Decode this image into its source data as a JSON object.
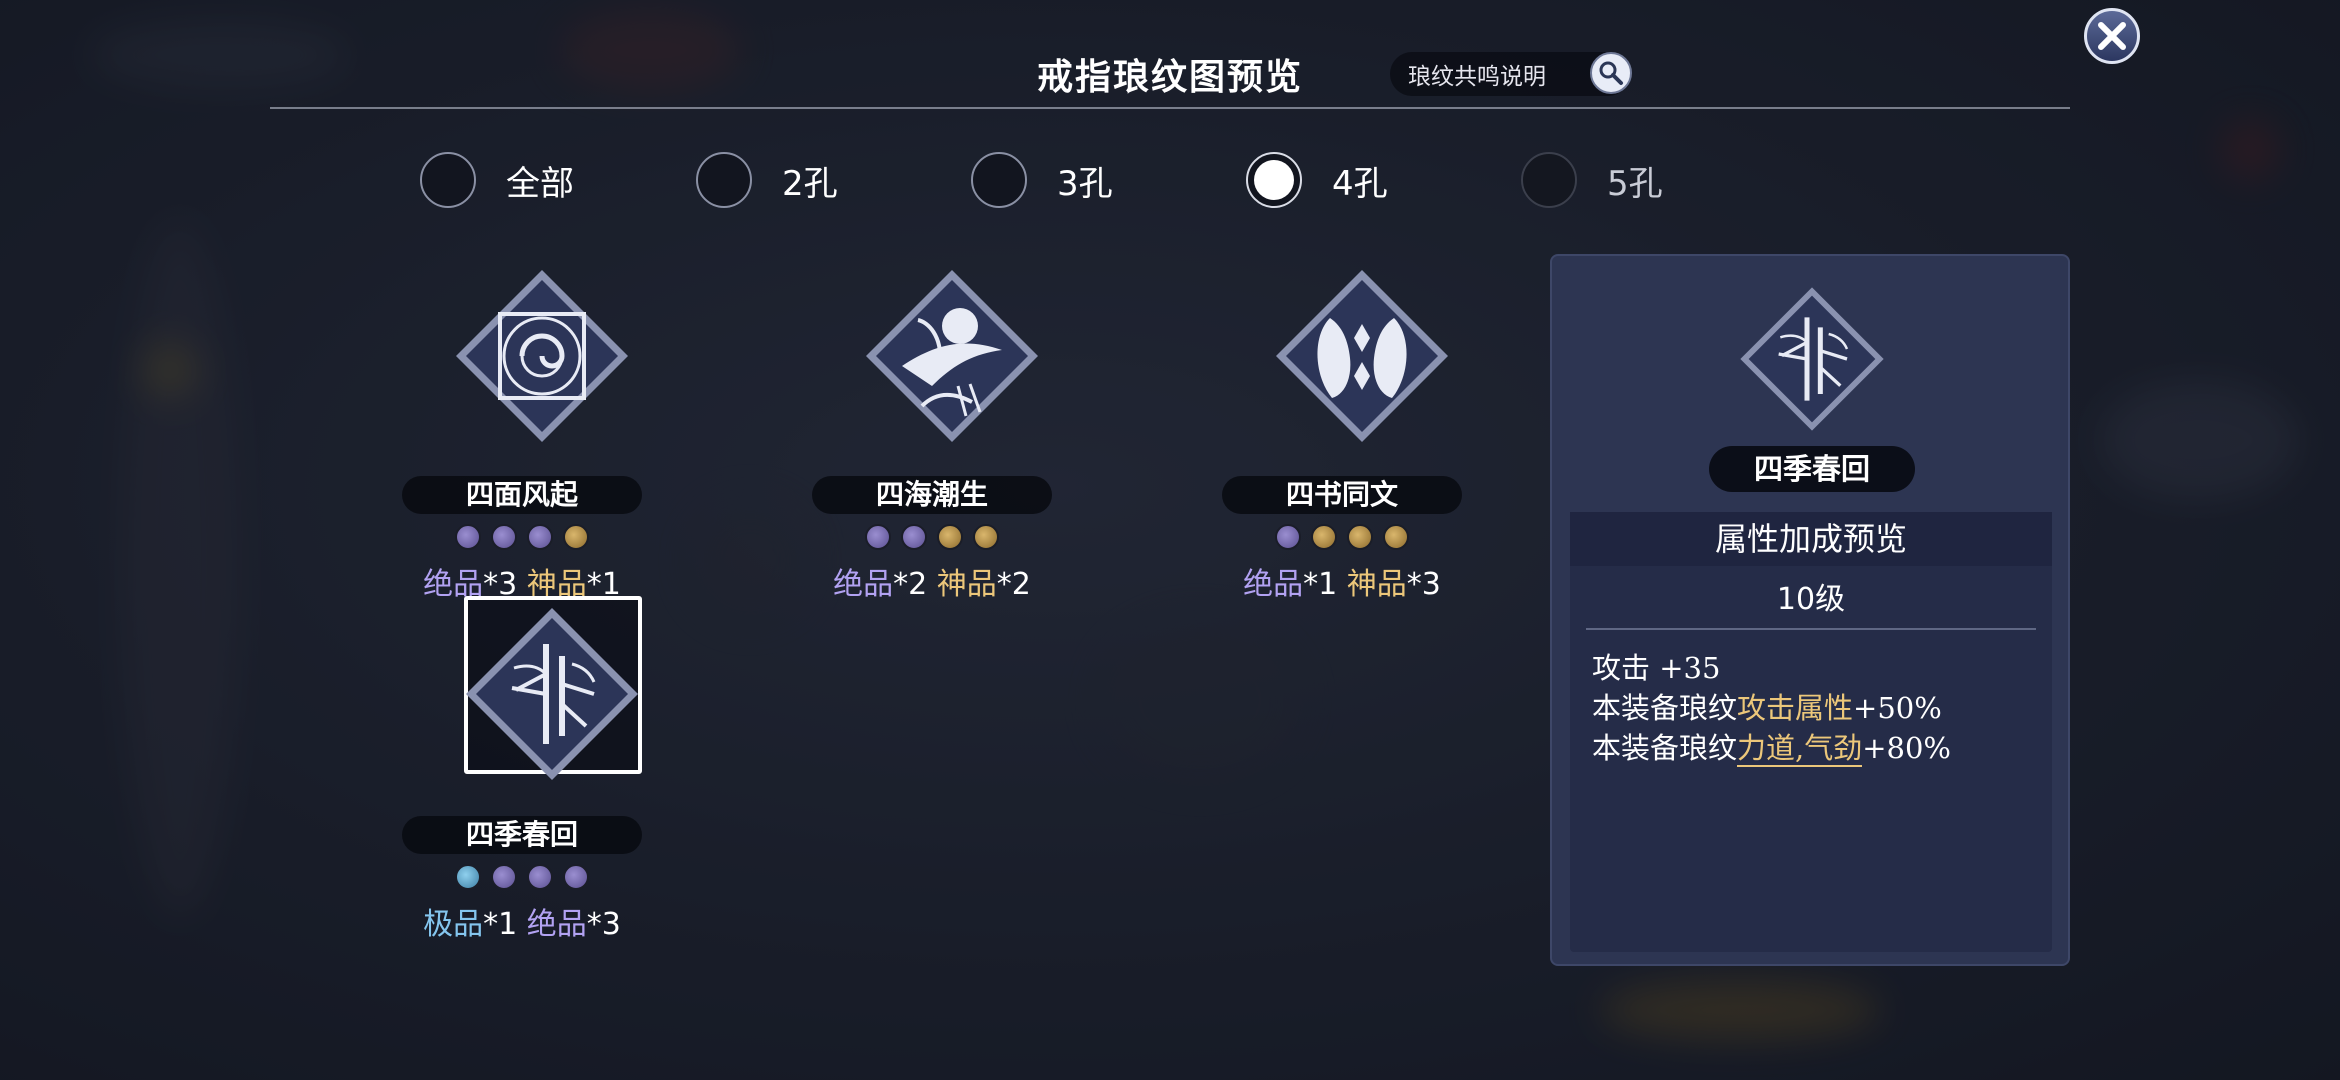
{
  "header": {
    "title": "戒指琅纹图预览",
    "help_label": "琅纹共鸣说明"
  },
  "icons": {
    "help": "magnifier-icon",
    "close": "close-x-icon"
  },
  "filters": [
    {
      "label": "全部",
      "selected": false,
      "enabled": true
    },
    {
      "label": "2孔",
      "selected": false,
      "enabled": true
    },
    {
      "label": "3孔",
      "selected": false,
      "enabled": true
    },
    {
      "label": "4孔",
      "selected": true,
      "enabled": true
    },
    {
      "label": "5孔",
      "selected": false,
      "enabled": false
    }
  ],
  "patterns": [
    {
      "name": "四面风起",
      "emblem": "swirl-emblem-icon",
      "sockets": [
        "purple",
        "purple",
        "purple",
        "gold"
      ],
      "q1": "绝品",
      "n1": "*3",
      "q2": "神品",
      "n2": "*1",
      "selected": false
    },
    {
      "name": "四海潮生",
      "emblem": "crane-emblem-icon",
      "sockets": [
        "purple",
        "purple",
        "gold",
        "gold"
      ],
      "q1": "绝品",
      "n1": "*2",
      "q2": "神品",
      "n2": "*2",
      "selected": false
    },
    {
      "name": "四书同文",
      "emblem": "twin-beast-emblem-icon",
      "sockets": [
        "purple",
        "gold",
        "gold",
        "gold"
      ],
      "q1": "绝品",
      "n1": "*1",
      "q2": "神品",
      "n2": "*3",
      "selected": false
    },
    {
      "name": "四季春回",
      "emblem": "bamboo-emblem-icon",
      "sockets": [
        "blue",
        "purple",
        "purple",
        "purple"
      ],
      "q1": "极品",
      "n1": "*1",
      "q2": "绝品",
      "n2": "*3",
      "selected": true
    }
  ],
  "detail": {
    "name": "四季春回",
    "title": "属性加成预览",
    "level": "10级",
    "stats": [
      {
        "label": "攻击",
        "value": "+35"
      },
      {
        "prefix": "本装备琅纹",
        "attr": "攻击属性",
        "value": "+50%"
      },
      {
        "prefix": "本装备琅纹",
        "attr": "力道,气劲",
        "value": "+80%"
      }
    ]
  },
  "colors": {
    "panel": "#2d3552",
    "gold": "#ecc77a",
    "purple": "#b2a2f2",
    "blue": "#84c5ee"
  }
}
